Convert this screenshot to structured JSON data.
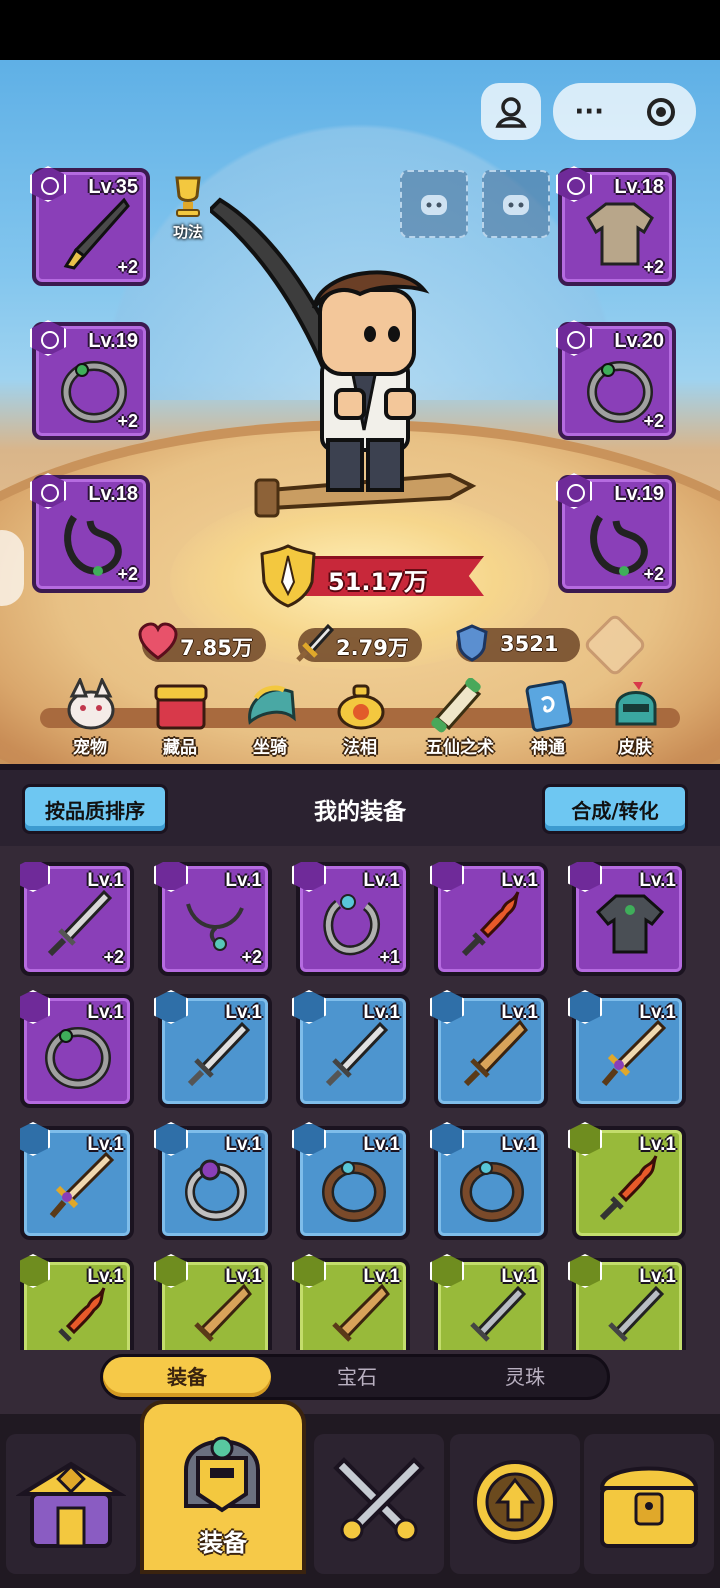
{
  "equipment_slots": [
    {
      "level": "Lv.35",
      "plus": "+2",
      "icon": "saber-icon"
    },
    {
      "level": "Lv.19",
      "plus": "+2",
      "icon": "ring-icon"
    },
    {
      "level": "Lv.18",
      "plus": "+2",
      "icon": "necklace-icon"
    },
    {
      "level": "Lv.18",
      "plus": "+2",
      "icon": "robe-icon"
    },
    {
      "level": "Lv.20",
      "plus": "+2",
      "icon": "ring-icon"
    },
    {
      "level": "Lv.19",
      "plus": "+2",
      "icon": "necklace-icon"
    }
  ],
  "gongfa_label": "功法",
  "power": "51.17万",
  "stats": {
    "hp": "7.85万",
    "attack": "2.79万",
    "defense": "3521"
  },
  "menu": [
    {
      "label": "宠物",
      "icon": "pet-icon"
    },
    {
      "label": "藏品",
      "icon": "treasure-chest-icon"
    },
    {
      "label": "坐骑",
      "icon": "mount-icon"
    },
    {
      "label": "法相",
      "icon": "teapot-icon"
    },
    {
      "label": "五仙之术",
      "icon": "scroll-icon"
    },
    {
      "label": "神通",
      "icon": "book-icon"
    },
    {
      "label": "皮肤",
      "icon": "helmet-icon"
    }
  ],
  "panel": {
    "sort_button": "按品质排序",
    "title": "我的装备",
    "merge_button": "合成/转化"
  },
  "items": [
    {
      "level": "Lv.1",
      "plus": "+2",
      "rarity": "purple",
      "icon": "sword-icon"
    },
    {
      "level": "Lv.1",
      "plus": "+2",
      "rarity": "purple",
      "icon": "necklace-icon"
    },
    {
      "level": "Lv.1",
      "plus": "+1",
      "rarity": "purple",
      "icon": "ring-icon"
    },
    {
      "level": "Lv.1",
      "plus": "",
      "rarity": "purple",
      "icon": "flame-sword-icon"
    },
    {
      "level": "Lv.1",
      "plus": "",
      "rarity": "purple",
      "icon": "robe-icon"
    },
    {
      "level": "Lv.1",
      "plus": "",
      "rarity": "purple",
      "icon": "ring-icon"
    },
    {
      "level": "Lv.1",
      "plus": "",
      "rarity": "blue",
      "icon": "sword-icon"
    },
    {
      "level": "Lv.1",
      "plus": "",
      "rarity": "blue",
      "icon": "sword-icon"
    },
    {
      "level": "Lv.1",
      "plus": "",
      "rarity": "blue",
      "icon": "sword-icon"
    },
    {
      "level": "Lv.1",
      "plus": "",
      "rarity": "blue",
      "icon": "sword-icon"
    },
    {
      "level": "Lv.1",
      "plus": "",
      "rarity": "blue",
      "icon": "sword-icon"
    },
    {
      "level": "Lv.1",
      "plus": "",
      "rarity": "blue",
      "icon": "ring-icon"
    },
    {
      "level": "Lv.1",
      "plus": "",
      "rarity": "blue",
      "icon": "ring-icon"
    },
    {
      "level": "Lv.1",
      "plus": "",
      "rarity": "blue",
      "icon": "ring-icon"
    },
    {
      "level": "Lv.1",
      "plus": "",
      "rarity": "green",
      "icon": "flame-sword-icon"
    },
    {
      "level": "Lv.1",
      "plus": "",
      "rarity": "green",
      "icon": "flame-sword-icon"
    },
    {
      "level": "Lv.1",
      "plus": "",
      "rarity": "green",
      "icon": "sword-icon"
    },
    {
      "level": "Lv.1",
      "plus": "",
      "rarity": "green",
      "icon": "sword-icon"
    },
    {
      "level": "Lv.1",
      "plus": "",
      "rarity": "green",
      "icon": "sword-icon"
    },
    {
      "level": "Lv.1",
      "plus": "",
      "rarity": "green",
      "icon": "sword-icon"
    }
  ],
  "tabs": {
    "equipment": "装备",
    "gem": "宝石",
    "pearl": "灵珠"
  },
  "bottom_nav": {
    "active_label": "装备"
  }
}
